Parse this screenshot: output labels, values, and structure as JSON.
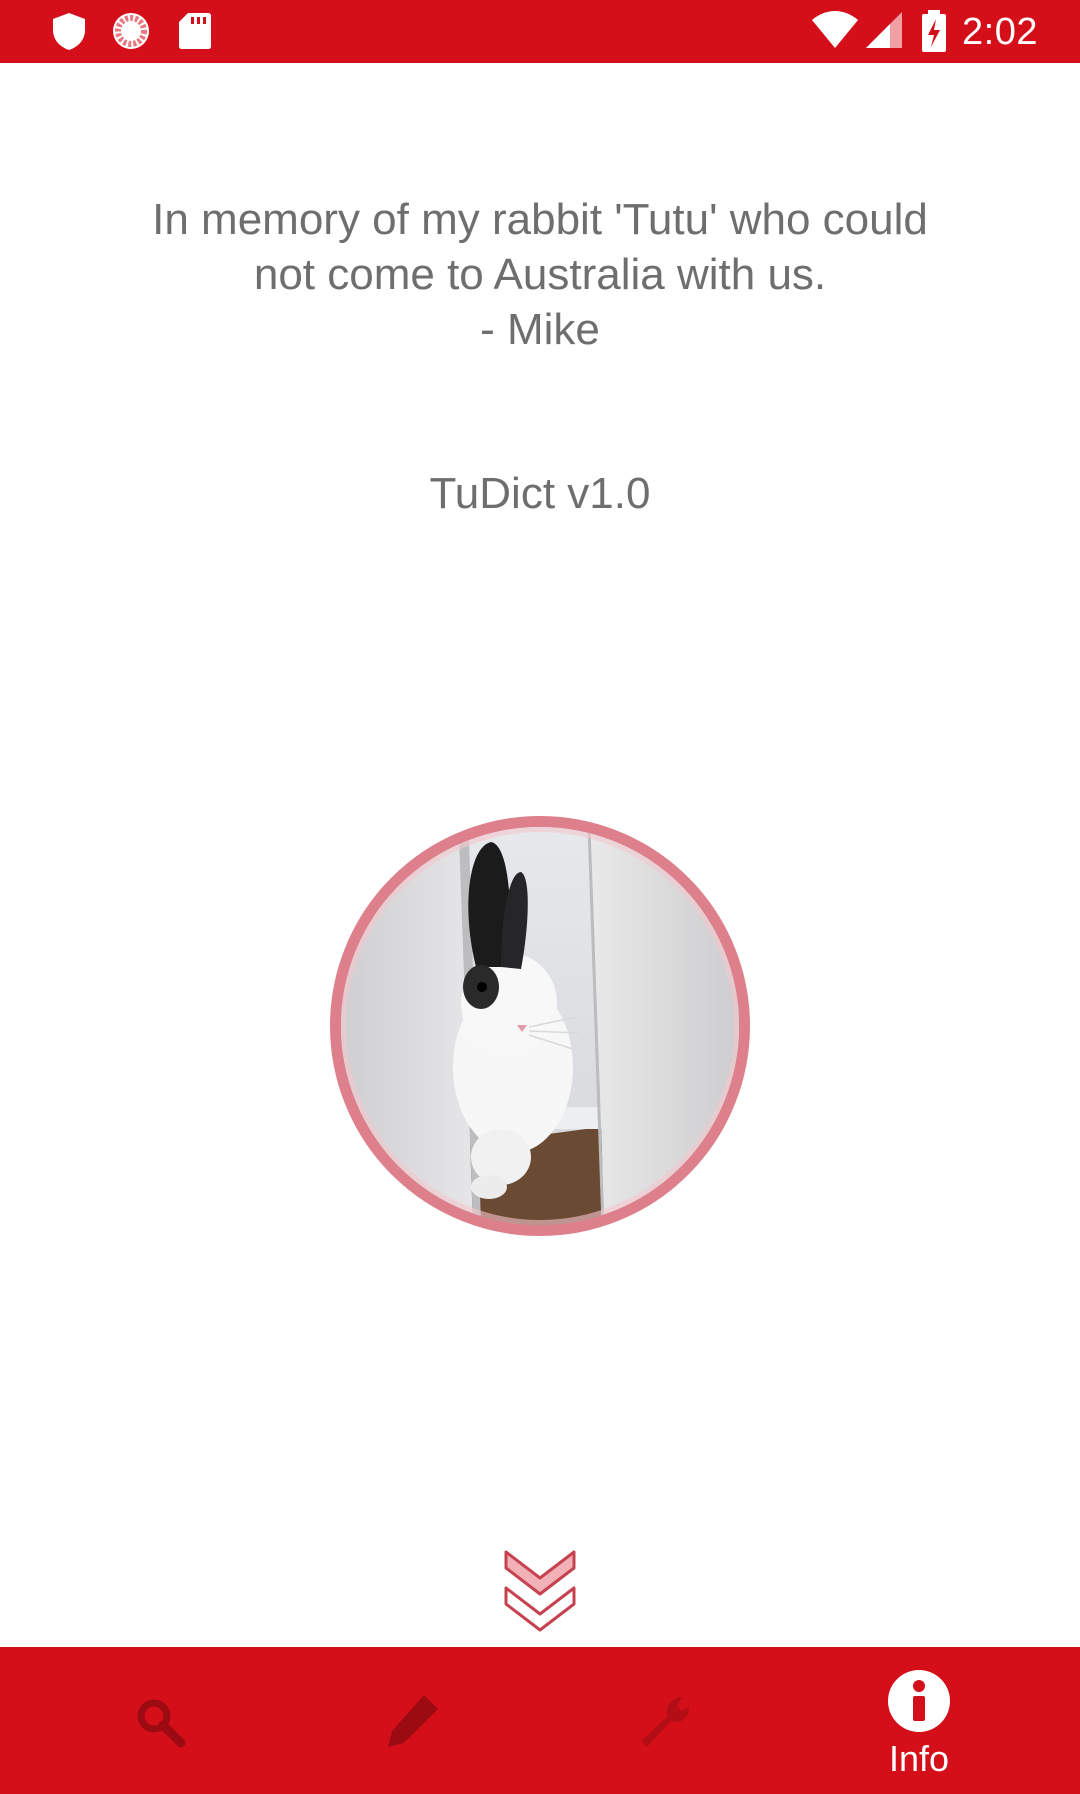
{
  "status_bar": {
    "time": "2:02",
    "left_icons": [
      "shield-icon",
      "sync-icon",
      "sd-card-icon"
    ],
    "right_icons": [
      "wifi-icon",
      "signal-icon",
      "battery-charging-icon"
    ]
  },
  "about": {
    "memorial_lines": [
      "In memory of my rabbit 'Tutu' who could",
      "not come to Australia with us.",
      "- Mike"
    ],
    "version": "TuDict v1.0",
    "photo_icon": "rabbit-photo"
  },
  "scroll_hint_icon": "double-chevron-down-icon",
  "bottom_nav": {
    "items": [
      {
        "icon": "search-icon",
        "label": ""
      },
      {
        "icon": "pencil-icon",
        "label": ""
      },
      {
        "icon": "wrench-icon",
        "label": ""
      },
      {
        "icon": "info-icon",
        "label": "Info",
        "selected": true
      }
    ]
  },
  "colors": {
    "primary": "#d50f1a",
    "inactive_icon": "#9c0a12",
    "text_gray": "#6e6e6e",
    "avatar_ring": "#de7f8c"
  }
}
